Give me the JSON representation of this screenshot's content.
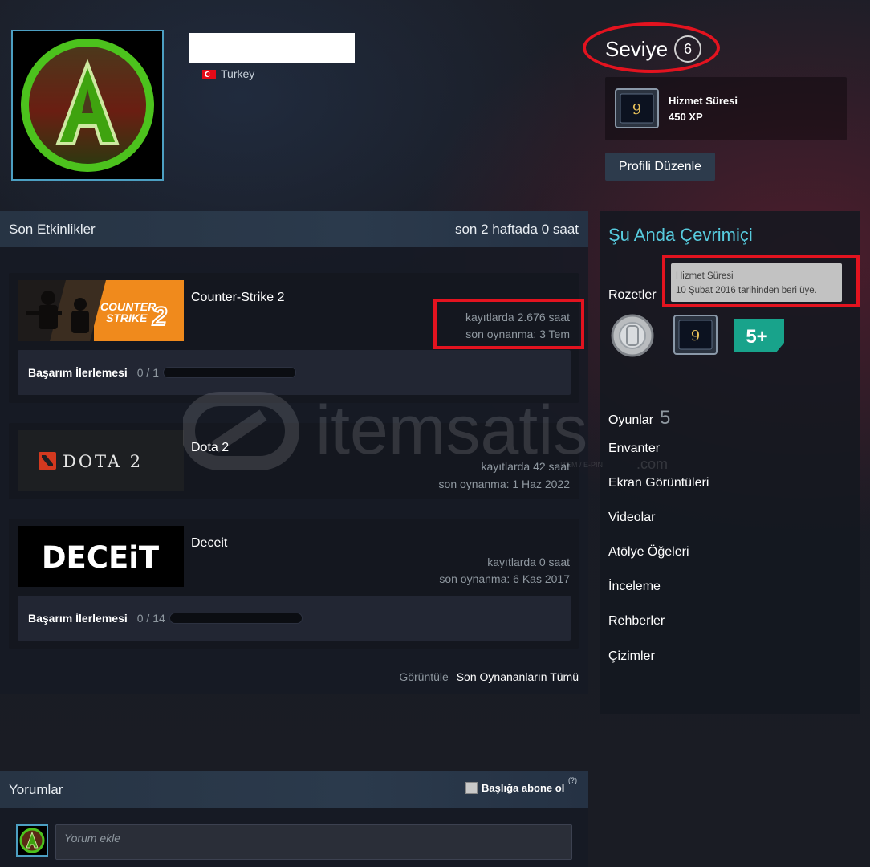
{
  "profile": {
    "country": "Turkey",
    "level_label": "Seviye",
    "level_value": "6",
    "badge": {
      "title": "Hizmet Süresi",
      "xp": "450 XP",
      "badge_number": "9"
    },
    "edit_button": "Profili Düzenle"
  },
  "recent": {
    "title": "Son Etkinlikler",
    "playtime_summary": "son 2 haftada 0 saat",
    "games": [
      {
        "name": "Counter-Strike 2",
        "hours": "kayıtlarda 2.676 saat",
        "last_played": "son oynanma: 3 Tem",
        "achievement_label": "Başarım İlerlemesi",
        "achievement_count": "0 / 1",
        "achievement_progress": 0,
        "capsule_text_1": "COUNTER",
        "capsule_text_2": "STRIKE",
        "capsule_number": "2"
      },
      {
        "name": "Dota 2",
        "hours": "kayıtlarda 42 saat",
        "last_played": "son oynanma: 1 Haz 2022",
        "capsule_text": "DOTA 2"
      },
      {
        "name": "Deceit",
        "hours": "kayıtlarda 0 saat",
        "last_played": "son oynanma: 6 Kas 2017",
        "achievement_label": "Başarım İlerlemesi",
        "achievement_count": "0 / 14",
        "achievement_progress": 0,
        "capsule_text": "DECEiT"
      }
    ],
    "view_label": "Görüntüle",
    "view_all_link": "Son Oynananların Tümü"
  },
  "sidebar": {
    "status": "Şu Anda Çevrimiçi",
    "badges_label": "Rozetler",
    "tooltip_title": "Hizmet Süresi",
    "tooltip_text": "10 Şubat 2016 tarihinden beri üye.",
    "badge_number": "9",
    "badge_plus": "5+",
    "games_label": "Oyunlar",
    "games_count": "5",
    "links": [
      "Envanter",
      "Ekran Görüntüleri",
      "Videolar",
      "Atölye Öğeleri",
      "İnceleme",
      "Rehberler",
      "Çizimler"
    ]
  },
  "comments": {
    "title": "Yorumlar",
    "subscribe_label": "Başlığa abone ol",
    "help": "(?)",
    "input_placeholder": "Yorum ekle"
  },
  "watermark": {
    "brand": "itemsatis",
    "tagline": "ITEM / E-PIN",
    "suffix": ".com"
  },
  "colors": {
    "accent_blue": "#57cbde",
    "highlight_red": "#e3131f",
    "avatar_green": "#4cc21d",
    "cs2_orange": "#f08a1c",
    "dota_red": "#d3391f"
  }
}
